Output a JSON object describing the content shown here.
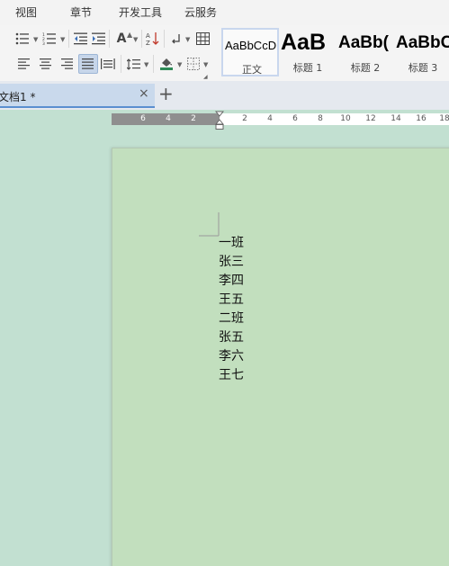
{
  "menu": {
    "tabs": [
      "视图",
      "章节",
      "开发工具",
      "云服务"
    ]
  },
  "ribbon": {
    "icons": [
      "bullet-list",
      "numbered-list",
      "decrease-indent",
      "increase-indent",
      "text-size",
      "sort",
      "show-marks",
      "table",
      "align-left",
      "align-center",
      "align-right",
      "justify",
      "distribute",
      "line-spacing",
      "shading",
      "borders"
    ],
    "font_size_button_label": "A"
  },
  "styles": [
    {
      "preview": "AaBbCcD",
      "label": "正文",
      "selected": true
    },
    {
      "preview": "AaB",
      "label": "标题 1",
      "selected": false
    },
    {
      "preview": "AaBb(",
      "label": "标题 2",
      "selected": false
    },
    {
      "preview": "AaBbC",
      "label": "标题 3",
      "selected": false
    }
  ],
  "document_tab": {
    "title": "文档1 *",
    "close_label": "×",
    "new_tab_label": "+"
  },
  "ruler": {
    "left_numbers": [
      "6",
      "4",
      "2"
    ],
    "right_numbers": [
      "2",
      "4",
      "6",
      "8",
      "10",
      "12",
      "14",
      "16",
      "18"
    ]
  },
  "document": {
    "lines": [
      "一班",
      "张三",
      "李四",
      "王五",
      "二班",
      "张五",
      "李六",
      "王七"
    ]
  },
  "colors": {
    "page_background": "#c2dfbe",
    "workspace_background": "#c2e0d1",
    "active_tab_underline": "#5b8fd0"
  }
}
